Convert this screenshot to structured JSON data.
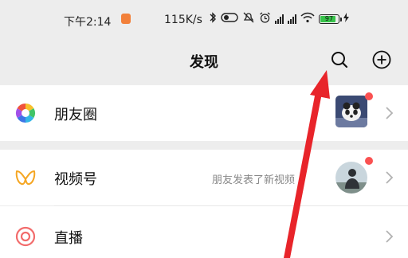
{
  "status_bar": {
    "time": "下午2:14",
    "speed": "115K/s",
    "battery": "97",
    "icons": [
      "bluetooth-icon",
      "hd-icon",
      "mute-icon",
      "alarm-icon",
      "signal-icon",
      "signal-icon",
      "wifi-icon",
      "battery-icon",
      "charging-icon"
    ]
  },
  "header": {
    "title": "发现",
    "search_icon": "search-icon",
    "add_icon": "plus-circle-icon"
  },
  "rows": [
    {
      "label": "朋友圈",
      "icon": "moments-icon",
      "has_badge": true
    },
    {
      "label": "视频号",
      "icon": "channels-icon",
      "description": "朋友发表了新视频",
      "has_badge": true
    },
    {
      "label": "直播",
      "icon": "live-icon"
    }
  ],
  "colors": {
    "background": "#ededed",
    "row_bg": "#ffffff",
    "badge": "#fa5151",
    "annotation_arrow": "#e8242a",
    "channels_icon": "#f5a623",
    "live_icon": "#f26b6b"
  }
}
